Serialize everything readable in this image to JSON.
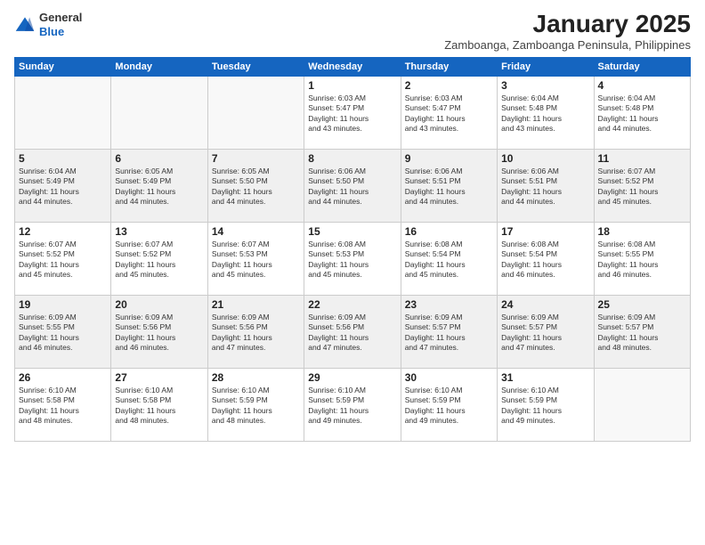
{
  "header": {
    "logo_line1": "General",
    "logo_line2": "Blue",
    "month_title": "January 2025",
    "subtitle": "Zamboanga, Zamboanga Peninsula, Philippines"
  },
  "weekdays": [
    "Sunday",
    "Monday",
    "Tuesday",
    "Wednesday",
    "Thursday",
    "Friday",
    "Saturday"
  ],
  "weeks": [
    [
      {
        "day": "",
        "text": ""
      },
      {
        "day": "",
        "text": ""
      },
      {
        "day": "",
        "text": ""
      },
      {
        "day": "1",
        "text": "Sunrise: 6:03 AM\nSunset: 5:47 PM\nDaylight: 11 hours\nand 43 minutes."
      },
      {
        "day": "2",
        "text": "Sunrise: 6:03 AM\nSunset: 5:47 PM\nDaylight: 11 hours\nand 43 minutes."
      },
      {
        "day": "3",
        "text": "Sunrise: 6:04 AM\nSunset: 5:48 PM\nDaylight: 11 hours\nand 43 minutes."
      },
      {
        "day": "4",
        "text": "Sunrise: 6:04 AM\nSunset: 5:48 PM\nDaylight: 11 hours\nand 44 minutes."
      }
    ],
    [
      {
        "day": "5",
        "text": "Sunrise: 6:04 AM\nSunset: 5:49 PM\nDaylight: 11 hours\nand 44 minutes."
      },
      {
        "day": "6",
        "text": "Sunrise: 6:05 AM\nSunset: 5:49 PM\nDaylight: 11 hours\nand 44 minutes."
      },
      {
        "day": "7",
        "text": "Sunrise: 6:05 AM\nSunset: 5:50 PM\nDaylight: 11 hours\nand 44 minutes."
      },
      {
        "day": "8",
        "text": "Sunrise: 6:06 AM\nSunset: 5:50 PM\nDaylight: 11 hours\nand 44 minutes."
      },
      {
        "day": "9",
        "text": "Sunrise: 6:06 AM\nSunset: 5:51 PM\nDaylight: 11 hours\nand 44 minutes."
      },
      {
        "day": "10",
        "text": "Sunrise: 6:06 AM\nSunset: 5:51 PM\nDaylight: 11 hours\nand 44 minutes."
      },
      {
        "day": "11",
        "text": "Sunrise: 6:07 AM\nSunset: 5:52 PM\nDaylight: 11 hours\nand 45 minutes."
      }
    ],
    [
      {
        "day": "12",
        "text": "Sunrise: 6:07 AM\nSunset: 5:52 PM\nDaylight: 11 hours\nand 45 minutes."
      },
      {
        "day": "13",
        "text": "Sunrise: 6:07 AM\nSunset: 5:52 PM\nDaylight: 11 hours\nand 45 minutes."
      },
      {
        "day": "14",
        "text": "Sunrise: 6:07 AM\nSunset: 5:53 PM\nDaylight: 11 hours\nand 45 minutes."
      },
      {
        "day": "15",
        "text": "Sunrise: 6:08 AM\nSunset: 5:53 PM\nDaylight: 11 hours\nand 45 minutes."
      },
      {
        "day": "16",
        "text": "Sunrise: 6:08 AM\nSunset: 5:54 PM\nDaylight: 11 hours\nand 45 minutes."
      },
      {
        "day": "17",
        "text": "Sunrise: 6:08 AM\nSunset: 5:54 PM\nDaylight: 11 hours\nand 46 minutes."
      },
      {
        "day": "18",
        "text": "Sunrise: 6:08 AM\nSunset: 5:55 PM\nDaylight: 11 hours\nand 46 minutes."
      }
    ],
    [
      {
        "day": "19",
        "text": "Sunrise: 6:09 AM\nSunset: 5:55 PM\nDaylight: 11 hours\nand 46 minutes."
      },
      {
        "day": "20",
        "text": "Sunrise: 6:09 AM\nSunset: 5:56 PM\nDaylight: 11 hours\nand 46 minutes."
      },
      {
        "day": "21",
        "text": "Sunrise: 6:09 AM\nSunset: 5:56 PM\nDaylight: 11 hours\nand 47 minutes."
      },
      {
        "day": "22",
        "text": "Sunrise: 6:09 AM\nSunset: 5:56 PM\nDaylight: 11 hours\nand 47 minutes."
      },
      {
        "day": "23",
        "text": "Sunrise: 6:09 AM\nSunset: 5:57 PM\nDaylight: 11 hours\nand 47 minutes."
      },
      {
        "day": "24",
        "text": "Sunrise: 6:09 AM\nSunset: 5:57 PM\nDaylight: 11 hours\nand 47 minutes."
      },
      {
        "day": "25",
        "text": "Sunrise: 6:09 AM\nSunset: 5:57 PM\nDaylight: 11 hours\nand 48 minutes."
      }
    ],
    [
      {
        "day": "26",
        "text": "Sunrise: 6:10 AM\nSunset: 5:58 PM\nDaylight: 11 hours\nand 48 minutes."
      },
      {
        "day": "27",
        "text": "Sunrise: 6:10 AM\nSunset: 5:58 PM\nDaylight: 11 hours\nand 48 minutes."
      },
      {
        "day": "28",
        "text": "Sunrise: 6:10 AM\nSunset: 5:59 PM\nDaylight: 11 hours\nand 48 minutes."
      },
      {
        "day": "29",
        "text": "Sunrise: 6:10 AM\nSunset: 5:59 PM\nDaylight: 11 hours\nand 49 minutes."
      },
      {
        "day": "30",
        "text": "Sunrise: 6:10 AM\nSunset: 5:59 PM\nDaylight: 11 hours\nand 49 minutes."
      },
      {
        "day": "31",
        "text": "Sunrise: 6:10 AM\nSunset: 5:59 PM\nDaylight: 11 hours\nand 49 minutes."
      },
      {
        "day": "",
        "text": ""
      }
    ]
  ]
}
